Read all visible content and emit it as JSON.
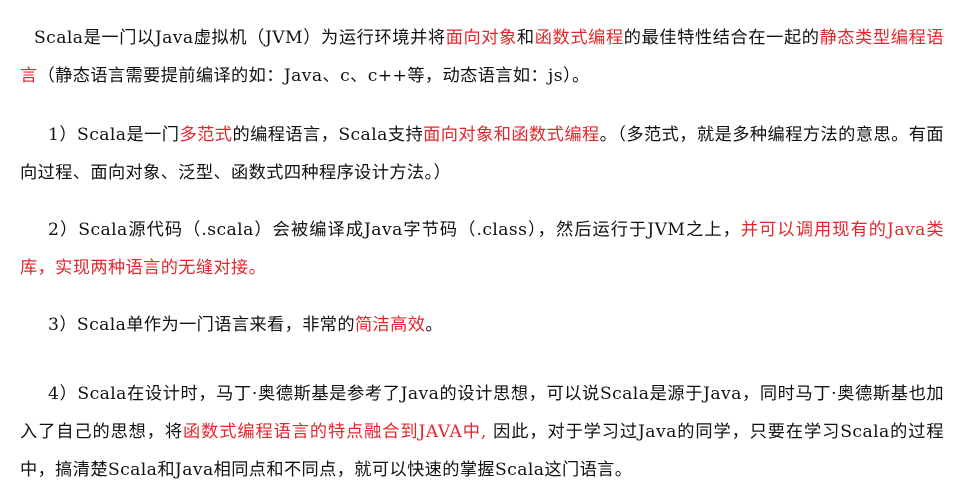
{
  "intro": {
    "t1": "Scala是一门以Java虚拟机（JVM）为运行环境并将",
    "h1": "面向对象",
    "t2": "和",
    "h2": "函数式编程",
    "t3": "的最佳特性结合在一起的",
    "h3": "静态类型编程语言",
    "t4": "（静态语言需要提前编译的如：Java、c、c++等，动态语言如：js）。"
  },
  "points": {
    "p1": {
      "t1": "1）Scala是一门",
      "h1": "多范式",
      "t2": "的编程语言，Scala支持",
      "h2": "面向对象和函数式编程",
      "t3": "。（多范式，就是多种编程方法的意思。有面向过程、面向对象、泛型、函数式四种程序设计方法。）"
    },
    "p2": {
      "t1": "2）Scala源代码（.scala）会被编译成Java字节码（.class），然后运行于JVM之上，",
      "h1": "并可以调用现有的Java类库，实现两种语言的无缝对接。"
    },
    "p3": {
      "t1": "3）Scala单作为一门语言来看，非常的",
      "h1": "简洁高效",
      "t2": "。"
    },
    "p4": {
      "t1": "4）Scala在设计时，马丁·奥德斯基是参考了Java的设计思想，可以说Scala是源于Java，同时马丁·奥德斯基也加入了自己的思想，将",
      "h1": "函数式编程语言的特点融合到JAVA中,",
      "t2": " 因此，对于学习过Java的同学，只要在学习Scala的过程中，搞清楚Scala和Java相同点和不同点，就可以快速的掌握Scala这门语言。"
    }
  },
  "colors": {
    "text": "#111111",
    "highlight": "#e3262c",
    "background": "#ffffff"
  }
}
